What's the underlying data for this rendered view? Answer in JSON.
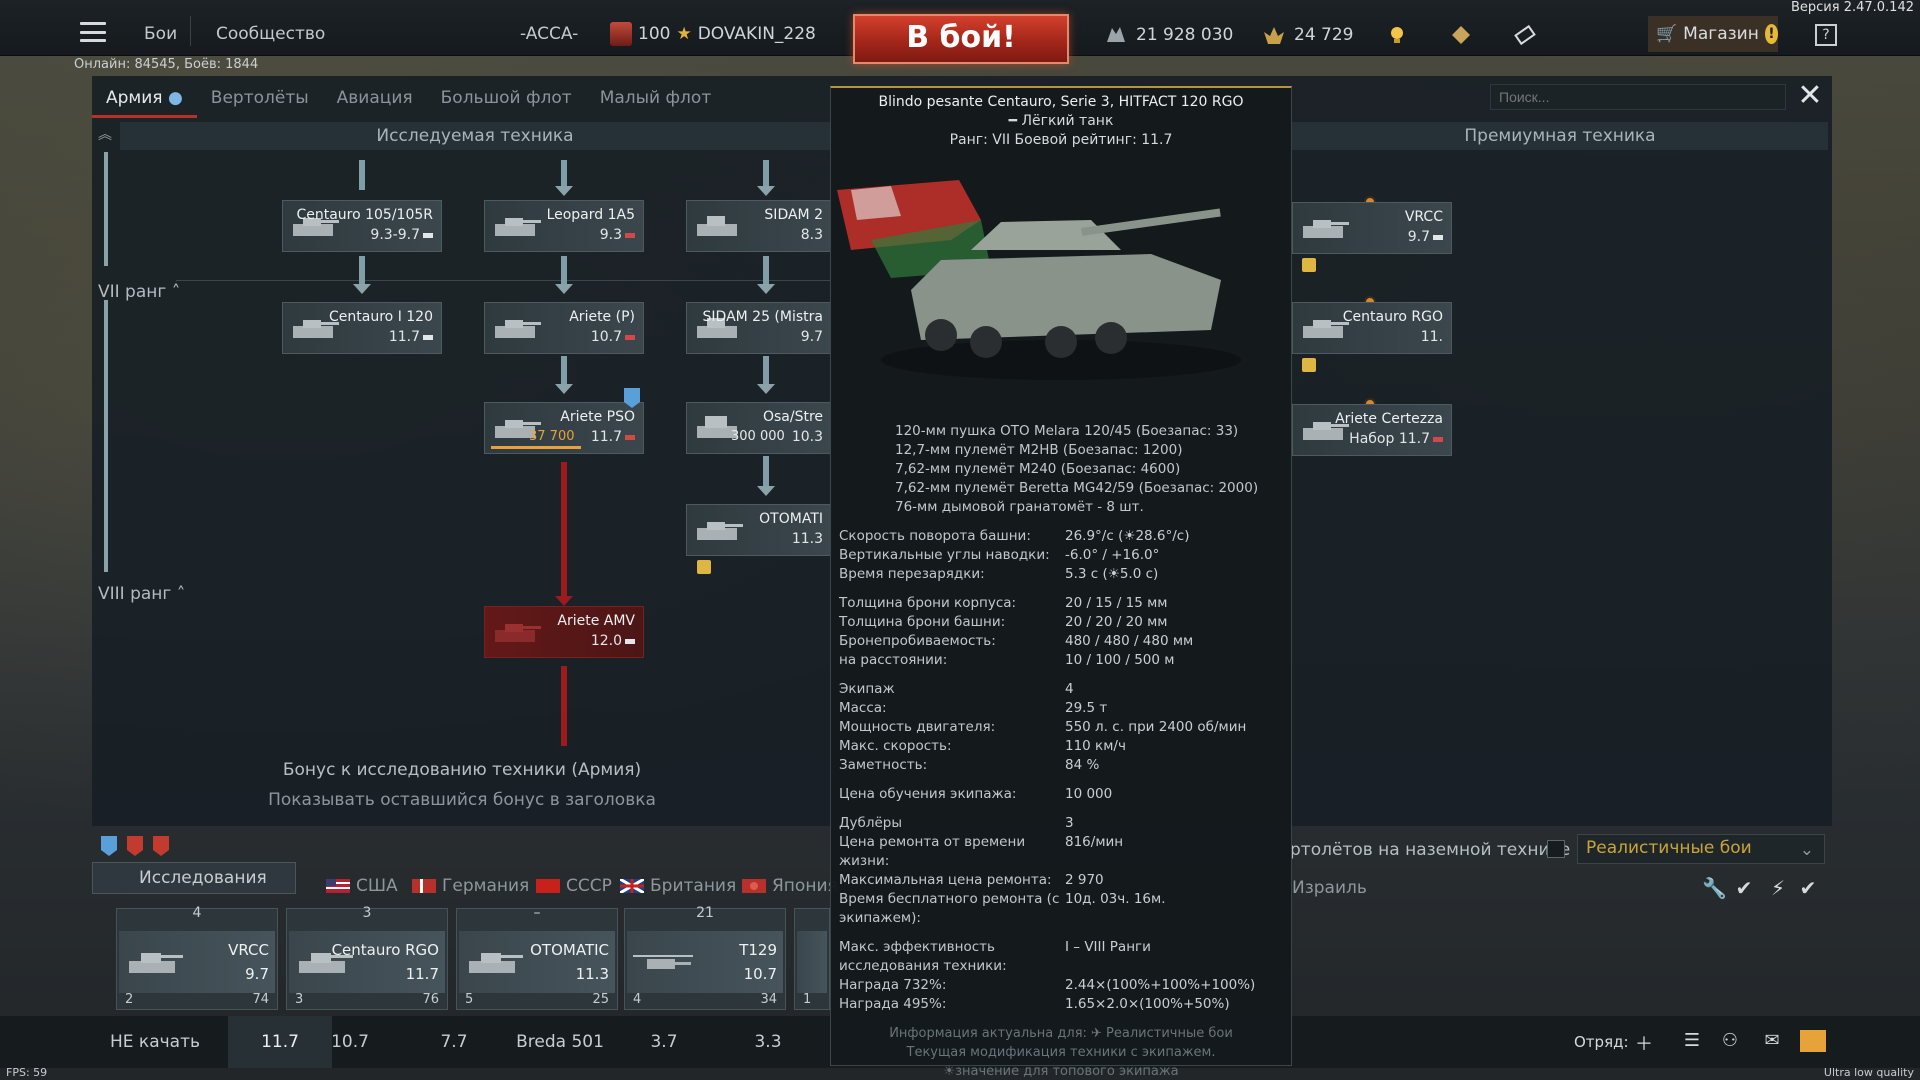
{
  "version": "Версия 2.47.0.142",
  "topbar": {
    "battles": "Бои",
    "community": "Сообщество",
    "squadron_tag": "-ACCA-",
    "level": "100",
    "username": "DOVAKIN_228",
    "battle_button": "В бой!",
    "silver_lions": "21 928 030",
    "eagles": "24 729",
    "shop": "Магазин",
    "help": "?"
  },
  "online": "Онлайн: 84545, Боёв: 1844",
  "tabs": [
    {
      "label": "Армия",
      "active": true
    },
    {
      "label": "Вертолёты"
    },
    {
      "label": "Авиация"
    },
    {
      "label": "Большой флот"
    },
    {
      "label": "Малый флот"
    }
  ],
  "search": {
    "placeholder": "Поиск..."
  },
  "sections": {
    "researched": "Исследуемая техника",
    "premium": "Премиумная техника"
  },
  "ranks": {
    "vii": "VII ранг",
    "viii": "VIII ранг"
  },
  "tree": {
    "centauro_105": {
      "name": "Centauro 105/105R",
      "br": "9.3-9.7"
    },
    "leopard": {
      "name": "Leopard 1A5",
      "br": "9.3"
    },
    "sidam_2": {
      "name": "SIDAM 2",
      "br": "8.3"
    },
    "centauro_i120": {
      "name": "Centauro I 120",
      "br": "11.7"
    },
    "ariete_p": {
      "name": "Ariete (P)",
      "br": "10.7"
    },
    "sidam_25": {
      "name": "SIDAM 25 (Mistra",
      "br": "9.7"
    },
    "ariete_pso": {
      "name": "Ariete PSO",
      "cost": "37 700",
      "br": "11.7"
    },
    "osa": {
      "name": "Osa/Stre",
      "cost": "300 000",
      "br": "10.3"
    },
    "otomatic": {
      "name": "OTOMATI",
      "br": "11.3"
    },
    "ariete_amv": {
      "name": "Ariete AMV",
      "br": "12.0"
    },
    "vrcc": {
      "name": "VRCC",
      "br": "9.7"
    },
    "centauro_rgo": {
      "name": "Centauro RGO",
      "br": "11."
    },
    "ariete_certezza": {
      "name": "Ariete Certezza",
      "br": "Набор 11.7"
    }
  },
  "bonus": {
    "line1": "Бонус к исследованию техники (Армия)",
    "line2": "Показывать оставшийся бонус в заголовка"
  },
  "bottom": {
    "research": "Исследования",
    "nations": [
      "США",
      "Германия",
      "СССР",
      "Британия",
      "Япония"
    ],
    "israel": "Израиль",
    "heli_text": "ртолётов на наземной технике",
    "battle_mode": "Реалистичные бои"
  },
  "slots": [
    {
      "count": "4",
      "name": "VRCC",
      "br": "9.7",
      "crew": "2",
      "pts": "74"
    },
    {
      "count": "3",
      "name": "Centauro RGO",
      "br": "11.7",
      "crew": "3",
      "pts": "76"
    },
    {
      "count": "–",
      "name": "OTOMATIC",
      "br": "11.3",
      "crew": "5",
      "pts": "25"
    },
    {
      "count": "21",
      "name": "T129",
      "br": "10.7",
      "crew": "4",
      "pts": "34"
    },
    {
      "count": "",
      "name": "",
      "br": "",
      "crew": "1",
      "pts": ""
    }
  ],
  "presets": [
    "НЕ качать",
    "11.7",
    "10.7",
    "7.7",
    "Breda 501",
    "3.7",
    "3.3"
  ],
  "squad": "Отряд:",
  "fps": "FPS: 59",
  "quality": "Ultra low quality",
  "tooltip": {
    "title": "Blindo pesante Centauro, Serie 3, HITFACT 120 RGO",
    "type": "━ Лёгкий танк",
    "rank": "Ранг: VII    Боевой рейтинг: 11.7",
    "armament": [
      "120-мм пушка OTO Melara 120/45 (Боезапас: 33)",
      "12,7-мм пулемёт M2HB (Боезапас: 1200)",
      "7,62-мм пулемёт M240 (Боезапас: 4600)",
      "7,62-мм пулемёт Beretta MG42/59 (Боезапас: 2000)",
      "76-мм дымовой гранатомёт - 8 шт."
    ],
    "group1": [
      {
        "k": "Скорость поворота башни:",
        "v": "26.9°/с (☀28.6°/с)"
      },
      {
        "k": "Вертикальные углы наводки:",
        "v": "-6.0° / +16.0°"
      },
      {
        "k": "Время перезарядки:",
        "v": "5.3 с (☀5.0 с)"
      }
    ],
    "group2": [
      {
        "k": "Толщина брони корпуса:",
        "v": "20 / 15 / 15 мм"
      },
      {
        "k": "Толщина брони башни:",
        "v": "20 / 20 / 20 мм"
      },
      {
        "k": "Бронепробиваемость:",
        "v": "480 / 480 / 480 мм"
      },
      {
        "k": "на расстоянии:",
        "v": "10 / 100 / 500 м"
      }
    ],
    "group3": [
      {
        "k": "Экипаж",
        "v": "4"
      },
      {
        "k": "Масса:",
        "v": "29.5 т"
      },
      {
        "k": "Мощность двигателя:",
        "v": "550 л. с. при 2400 об/мин"
      },
      {
        "k": "Макс. скорость:",
        "v": "110 км/ч"
      },
      {
        "k": "Заметность:",
        "v": "84 %"
      }
    ],
    "crew_cost": {
      "k": "Цена обучения экипажа:",
      "v": "10 000"
    },
    "group4": [
      {
        "k": "Дублёры",
        "v": "3"
      },
      {
        "k": "Цена ремонта от времени жизни:",
        "v": "816/мин"
      },
      {
        "k": "Максимальная цена ремонта:",
        "v": "2 970"
      },
      {
        "k": "Время бесплатного ремонта (с экипажем):",
        "v": "10д. 03ч. 16м."
      }
    ],
    "group5": [
      {
        "k": "Макс. эффективность исследования техники:",
        "v": "I – VIII Ранги"
      },
      {
        "k": "Награда 732%:",
        "v": "2.44×(100%+100%+100%)"
      },
      {
        "k": "Награда 495%:",
        "v": "1.65×2.0×(100%+50%)"
      }
    ],
    "footer": [
      "Информация актуальна для: ✈ Реалистичные бои",
      "Текущая модификация техники с экипажем.",
      "☀значение для топового экипажа"
    ]
  }
}
